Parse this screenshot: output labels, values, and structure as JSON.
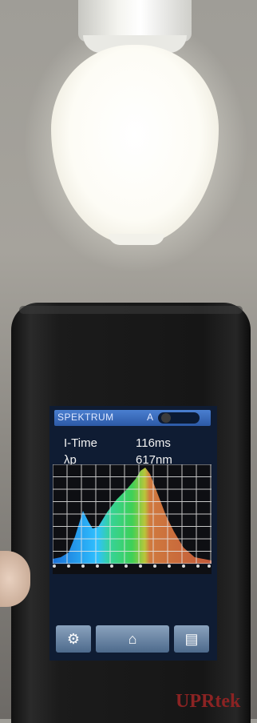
{
  "screen": {
    "title": "SPEKTRUM",
    "auto_badge": "A",
    "rows": [
      {
        "label": "I-Time",
        "value": "116ms"
      },
      {
        "label": "λp",
        "value": "617nm"
      }
    ],
    "buttons": [
      {
        "icon": "gear-icon",
        "glyph": "⚙"
      },
      {
        "icon": "home-icon",
        "glyph": "⌂"
      },
      {
        "icon": "save-icon",
        "glyph": "▤"
      }
    ]
  },
  "brand": "UPRtek",
  "colors": {
    "header": "#3a6cc0",
    "spectrum_blue": "#2fa7ff",
    "spectrum_green": "#46c957",
    "spectrum_orange": "#cf6a3f",
    "brand": "#8b2323"
  }
}
